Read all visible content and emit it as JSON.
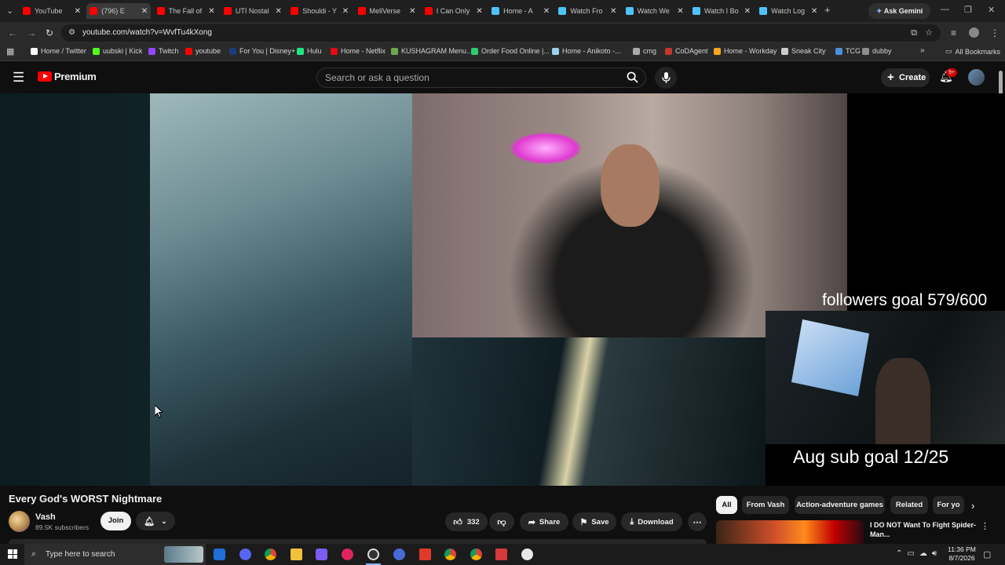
{
  "browser": {
    "tabs": [
      {
        "title": "YouTube",
        "color": "#ff0000",
        "active": false
      },
      {
        "title": "(796) E",
        "color": "#ff0000",
        "active": true
      },
      {
        "title": "The Fall of",
        "color": "#ff0000",
        "active": false
      },
      {
        "title": "UTI Nostal",
        "color": "#ff0000",
        "active": false
      },
      {
        "title": "Shouldi - Y",
        "color": "#ff0000",
        "active": false
      },
      {
        "title": "MellVerse",
        "color": "#ff0000",
        "active": false
      },
      {
        "title": "I Can Only",
        "color": "#ff0000",
        "active": false
      },
      {
        "title": "Home - A",
        "color": "#4fc3f7",
        "active": false
      },
      {
        "title": "Watch Fro",
        "color": "#4fc3f7",
        "active": false
      },
      {
        "title": "Watch We",
        "color": "#4fc3f7",
        "active": false
      },
      {
        "title": "Watch I Bo",
        "color": "#4fc3f7",
        "active": false
      },
      {
        "title": "Watch Log",
        "color": "#4fc3f7",
        "active": false
      }
    ],
    "ask_gemini": "Ask Gemini",
    "url": "youtube.com/watch?v=WvfTu4kXong",
    "bookmarks": [
      {
        "label": "Home / Twitter",
        "color": "#ffffff"
      },
      {
        "label": "uubski | Kick",
        "color": "#53fc18"
      },
      {
        "label": "Twitch",
        "color": "#9146ff"
      },
      {
        "label": "youtube",
        "color": "#ff0000"
      },
      {
        "label": "For You | Disney+",
        "color": "#1a3c7a"
      },
      {
        "label": "Hulu",
        "color": "#1ce783"
      },
      {
        "label": "Home - Netflix",
        "color": "#e50914"
      },
      {
        "label": "KUSHAGRAM Menu...",
        "color": "#6aa84f"
      },
      {
        "label": "Order Food Online |...",
        "color": "#2ecc71"
      },
      {
        "label": "Home - Anikoto -...",
        "color": "#9ad0ec"
      },
      {
        "label": "cmg",
        "color": "#aaaaaa"
      },
      {
        "label": "CoDAgent",
        "color": "#c0392b"
      },
      {
        "label": "Home - Workday",
        "color": "#f5a623"
      },
      {
        "label": "Sneak City",
        "color": "#cccccc"
      },
      {
        "label": "TCG",
        "color": "#4a90d9"
      },
      {
        "label": "dubby",
        "color": "#8e8e8e"
      }
    ],
    "all_bookmarks": "All Bookmarks"
  },
  "youtube": {
    "logo_text": "Premium",
    "search_placeholder": "Search or ask a question",
    "create_label": "Create",
    "notification_badge": "9+",
    "video": {
      "overlay_followers": "followers goal 579/600",
      "overlay_subs": "Aug sub goal 12/25"
    },
    "title": "Every God's WORST Nightmare",
    "channel": {
      "name": "Vash",
      "subscribers": "89.5K subscribers"
    },
    "join_label": "Join",
    "like_count": "332",
    "share_label": "Share",
    "save_label": "Save",
    "download_label": "Download",
    "chips": [
      "All",
      "From Vash",
      "Action-adventure games",
      "Related",
      "For yo"
    ],
    "rec": {
      "title_line1": "I DO NOT Want To Fight Spider-",
      "title_line2": "Man..."
    }
  },
  "taskbar": {
    "search_placeholder": "Type here to search",
    "time": "11:36 PM",
    "date": "8/7/2026"
  }
}
